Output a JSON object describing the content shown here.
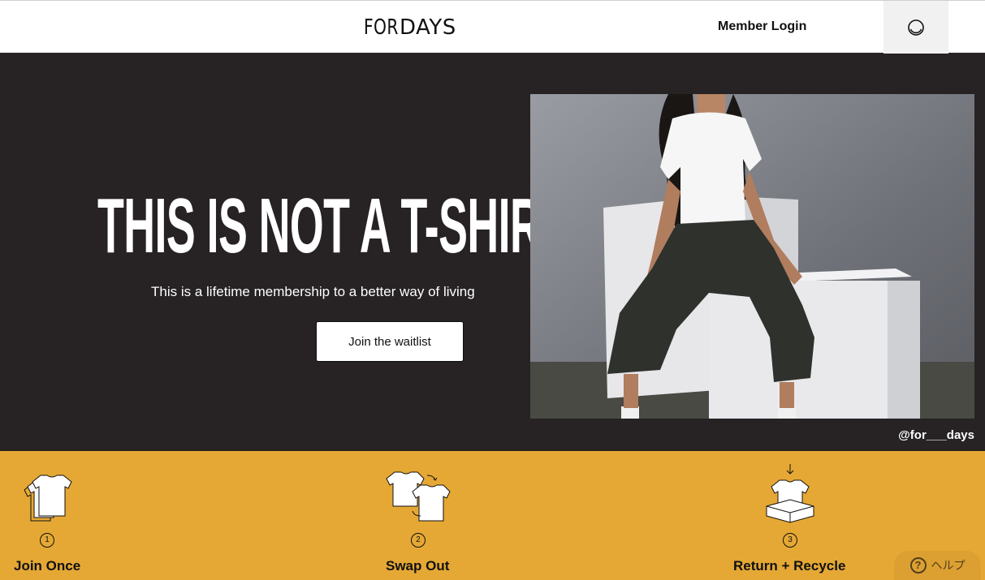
{
  "header": {
    "logo_part1": "FOR",
    "logo_part2": "DAYS",
    "member_login": "Member Login",
    "cart_icon": "circle-icon"
  },
  "hero": {
    "headline": "THIS IS NOT A T-SHIRT",
    "subline": "This is a lifetime membership to a better way of living",
    "cta": "Join the waitlist",
    "handle": "@for___days",
    "photo_icon": "person-photo"
  },
  "steps": [
    {
      "number": "1",
      "title": "Join Once",
      "icon": "stacked-tshirts-icon"
    },
    {
      "number": "2",
      "title": "Swap Out",
      "icon": "swap-tshirts-icon"
    },
    {
      "number": "3",
      "title": "Return + Recycle",
      "icon": "box-tshirt-icon"
    }
  ],
  "help": {
    "label": "ヘルプ",
    "icon": "question-icon"
  },
  "colors": {
    "hero_bg": "#272223",
    "steps_bg": "#e5a834",
    "header_bg": "#ffffff"
  }
}
